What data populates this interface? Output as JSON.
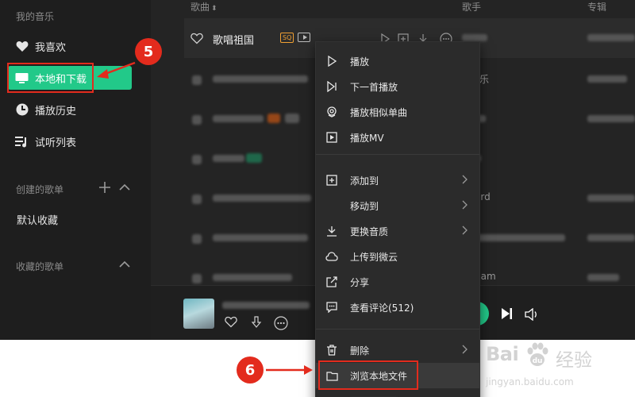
{
  "sidebar": {
    "my_music_title": "我的音乐",
    "items": [
      {
        "label": "我喜欢",
        "icon": "heart-icon"
      },
      {
        "label": "本地和下载",
        "icon": "monitor-icon"
      },
      {
        "label": "播放历史",
        "icon": "clock-icon"
      },
      {
        "label": "试听列表",
        "icon": "playlist-icon"
      }
    ],
    "created_title": "创建的歌单",
    "default_playlist": "默认收藏",
    "collected_title": "收藏的歌单"
  },
  "list": {
    "headers": {
      "song": "歌曲",
      "artist": "歌手",
      "album": "专辑"
    },
    "first_song": "歌唱祖国",
    "sq_badge": "SQ",
    "mv_icon": "mv-icon",
    "partial_artist_texts": [
      "乐",
      "",
      "乐",
      "",
      "ard",
      "Sam"
    ]
  },
  "context_menu": {
    "items": [
      {
        "label": "播放",
        "icon": "play-icon"
      },
      {
        "label": "下一首播放",
        "icon": "play-next-icon"
      },
      {
        "label": "播放相似单曲",
        "icon": "similar-icon"
      },
      {
        "label": "播放MV",
        "icon": "mv-play-icon"
      },
      {
        "label": "添加到",
        "icon": "add-icon"
      },
      {
        "label": "移动到",
        "icon": ""
      },
      {
        "label": "更换音质",
        "icon": "download-icon"
      },
      {
        "label": "上传到微云",
        "icon": "cloud-icon"
      },
      {
        "label": "分享",
        "icon": "share-icon"
      },
      {
        "label": "查看评论(512)",
        "icon": "comment-icon"
      },
      {
        "label": "删除",
        "icon": "trash-icon"
      },
      {
        "label": "浏览本地文件",
        "icon": "folder-icon"
      }
    ]
  },
  "annotations": {
    "step5": "5",
    "step6": "6"
  },
  "watermark": {
    "brand": "Bai",
    "brand_cn": "经验",
    "url": "jingyan.baidu.com"
  },
  "colors": {
    "accent": "#22c989",
    "annotation_red": "#e32b1d",
    "bg_dark": "#242424",
    "sidebar_bg": "#1e1e1e"
  }
}
